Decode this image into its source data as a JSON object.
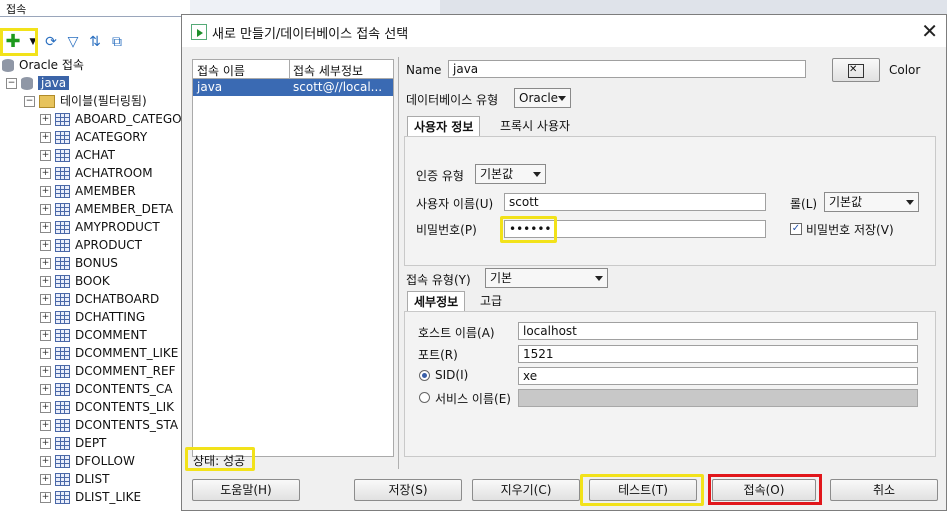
{
  "left_panel": {
    "title": "접속",
    "root_label": "Oracle 접속",
    "connection": "java",
    "tables_folder": "테이블(필터링됨)",
    "tables": [
      "ABOARD_CATEGO",
      "ACATEGORY",
      "ACHAT",
      "ACHATROOM",
      "AMEMBER",
      "AMEMBER_DETA",
      "AMYPRODUCT",
      "APRODUCT",
      "BONUS",
      "BOOK",
      "DCHATBOARD",
      "DCHATTING",
      "DCOMMENT",
      "DCOMMENT_LIKE",
      "DCOMMENT_REF",
      "DCONTENTS_CA",
      "DCONTENTS_LIK",
      "DCONTENTS_STA",
      "DEPT",
      "DFOLLOW",
      "DLIST",
      "DLIST_LIKE"
    ]
  },
  "dialog": {
    "title": "새로 만들기/데이터베이스 접속 선택",
    "list": {
      "col_name": "접속 이름",
      "col_detail": "접속 세부정보",
      "rows": [
        {
          "name": "java",
          "detail": "scott@//local..."
        }
      ]
    },
    "status": "상태: 성공",
    "name_label": "Name",
    "name_value": "java",
    "color_label": "Color",
    "db_type_label": "데이터베이스 유형",
    "db_type_value": "Oracle",
    "tabs": [
      "사용자 정보",
      "프록시 사용자"
    ],
    "auth_type_label": "인증 유형",
    "auth_type_value": "기본값",
    "username_label": "사용자 이름(U)",
    "username_value": "scott",
    "role_label": "롤(L)",
    "role_value": "기본값",
    "password_label": "비밀번호(P)",
    "password_value": "••••••",
    "save_password_label": "비밀번호 저장(V)",
    "conn_type_label": "접속 유형(Y)",
    "conn_type_value": "기본",
    "detail_tabs": [
      "세부정보",
      "고급"
    ],
    "host_label": "호스트 이름(A)",
    "host_value": "localhost",
    "port_label": "포트(R)",
    "port_value": "1521",
    "sid_label": "SID(I)",
    "sid_value": "xe",
    "service_label": "서비스 이름(E)",
    "service_value": "",
    "buttons": {
      "help": "도움말(H)",
      "save": "저장(S)",
      "clear": "지우기(C)",
      "test": "테스트(T)",
      "connect": "접속(O)",
      "cancel": "취소"
    }
  },
  "colors": {
    "highlight_yellow": "#f2e21a",
    "highlight_red": "#e1161b",
    "selection": "#3a6ab3"
  }
}
